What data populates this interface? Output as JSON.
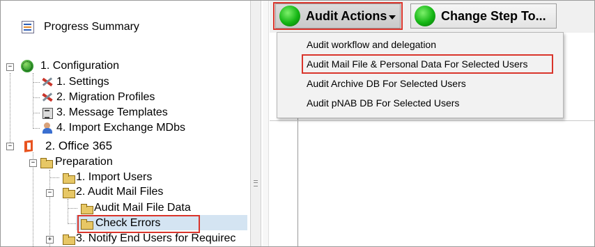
{
  "tree": {
    "progress_summary": "Progress Summary",
    "configuration": "1. Configuration",
    "settings": "1. Settings",
    "migration_profiles": "2. Migration Profiles",
    "message_templates": "3. Message Templates",
    "import_exchange": "4. Import Exchange MDbs",
    "office365": "2. Office 365",
    "preparation": "Preparation",
    "import_users": "1. Import Users",
    "audit_mail_files": "2. Audit Mail Files",
    "audit_mail_file_data": "Audit Mail File Data",
    "check_errors": "Check Errors",
    "notify_end_users": "3. Notify End Users for Requirec",
    "expander_minus": "−",
    "expander_plus": "+"
  },
  "toolbar": {
    "audit_actions": "Audit Actions",
    "change_step": "Change Step To..."
  },
  "menu": {
    "items": [
      "Audit workflow and delegation",
      "Audit Mail File & Personal Data For Selected Users",
      "Audit Archive DB For Selected Users",
      "Audit pNAB DB For Selected Users"
    ],
    "highlighted_index": 1
  },
  "colors": {
    "highlight_border": "#d9342b",
    "selection": "#d4e4f2"
  }
}
